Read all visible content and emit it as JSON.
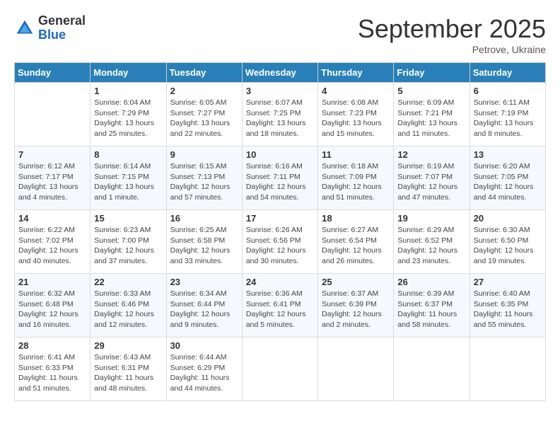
{
  "logo": {
    "general": "General",
    "blue": "Blue"
  },
  "header": {
    "month": "September 2025",
    "location": "Petrove, Ukraine"
  },
  "weekdays": [
    "Sunday",
    "Monday",
    "Tuesday",
    "Wednesday",
    "Thursday",
    "Friday",
    "Saturday"
  ],
  "weeks": [
    [
      {
        "day": "",
        "info": ""
      },
      {
        "day": "1",
        "info": "Sunrise: 6:04 AM\nSunset: 7:29 PM\nDaylight: 13 hours\nand 25 minutes."
      },
      {
        "day": "2",
        "info": "Sunrise: 6:05 AM\nSunset: 7:27 PM\nDaylight: 13 hours\nand 22 minutes."
      },
      {
        "day": "3",
        "info": "Sunrise: 6:07 AM\nSunset: 7:25 PM\nDaylight: 13 hours\nand 18 minutes."
      },
      {
        "day": "4",
        "info": "Sunrise: 6:08 AM\nSunset: 7:23 PM\nDaylight: 13 hours\nand 15 minutes."
      },
      {
        "day": "5",
        "info": "Sunrise: 6:09 AM\nSunset: 7:21 PM\nDaylight: 13 hours\nand 11 minutes."
      },
      {
        "day": "6",
        "info": "Sunrise: 6:11 AM\nSunset: 7:19 PM\nDaylight: 13 hours\nand 8 minutes."
      }
    ],
    [
      {
        "day": "7",
        "info": "Sunrise: 6:12 AM\nSunset: 7:17 PM\nDaylight: 13 hours\nand 4 minutes."
      },
      {
        "day": "8",
        "info": "Sunrise: 6:14 AM\nSunset: 7:15 PM\nDaylight: 13 hours\nand 1 minute."
      },
      {
        "day": "9",
        "info": "Sunrise: 6:15 AM\nSunset: 7:13 PM\nDaylight: 12 hours\nand 57 minutes."
      },
      {
        "day": "10",
        "info": "Sunrise: 6:16 AM\nSunset: 7:11 PM\nDaylight: 12 hours\nand 54 minutes."
      },
      {
        "day": "11",
        "info": "Sunrise: 6:18 AM\nSunset: 7:09 PM\nDaylight: 12 hours\nand 51 minutes."
      },
      {
        "day": "12",
        "info": "Sunrise: 6:19 AM\nSunset: 7:07 PM\nDaylight: 12 hours\nand 47 minutes."
      },
      {
        "day": "13",
        "info": "Sunrise: 6:20 AM\nSunset: 7:05 PM\nDaylight: 12 hours\nand 44 minutes."
      }
    ],
    [
      {
        "day": "14",
        "info": "Sunrise: 6:22 AM\nSunset: 7:02 PM\nDaylight: 12 hours\nand 40 minutes."
      },
      {
        "day": "15",
        "info": "Sunrise: 6:23 AM\nSunset: 7:00 PM\nDaylight: 12 hours\nand 37 minutes."
      },
      {
        "day": "16",
        "info": "Sunrise: 6:25 AM\nSunset: 6:58 PM\nDaylight: 12 hours\nand 33 minutes."
      },
      {
        "day": "17",
        "info": "Sunrise: 6:26 AM\nSunset: 6:56 PM\nDaylight: 12 hours\nand 30 minutes."
      },
      {
        "day": "18",
        "info": "Sunrise: 6:27 AM\nSunset: 6:54 PM\nDaylight: 12 hours\nand 26 minutes."
      },
      {
        "day": "19",
        "info": "Sunrise: 6:29 AM\nSunset: 6:52 PM\nDaylight: 12 hours\nand 23 minutes."
      },
      {
        "day": "20",
        "info": "Sunrise: 6:30 AM\nSunset: 6:50 PM\nDaylight: 12 hours\nand 19 minutes."
      }
    ],
    [
      {
        "day": "21",
        "info": "Sunrise: 6:32 AM\nSunset: 6:48 PM\nDaylight: 12 hours\nand 16 minutes."
      },
      {
        "day": "22",
        "info": "Sunrise: 6:33 AM\nSunset: 6:46 PM\nDaylight: 12 hours\nand 12 minutes."
      },
      {
        "day": "23",
        "info": "Sunrise: 6:34 AM\nSunset: 6:44 PM\nDaylight: 12 hours\nand 9 minutes."
      },
      {
        "day": "24",
        "info": "Sunrise: 6:36 AM\nSunset: 6:41 PM\nDaylight: 12 hours\nand 5 minutes."
      },
      {
        "day": "25",
        "info": "Sunrise: 6:37 AM\nSunset: 6:39 PM\nDaylight: 12 hours\nand 2 minutes."
      },
      {
        "day": "26",
        "info": "Sunrise: 6:39 AM\nSunset: 6:37 PM\nDaylight: 11 hours\nand 58 minutes."
      },
      {
        "day": "27",
        "info": "Sunrise: 6:40 AM\nSunset: 6:35 PM\nDaylight: 11 hours\nand 55 minutes."
      }
    ],
    [
      {
        "day": "28",
        "info": "Sunrise: 6:41 AM\nSunset: 6:33 PM\nDaylight: 11 hours\nand 51 minutes."
      },
      {
        "day": "29",
        "info": "Sunrise: 6:43 AM\nSunset: 6:31 PM\nDaylight: 11 hours\nand 48 minutes."
      },
      {
        "day": "30",
        "info": "Sunrise: 6:44 AM\nSunset: 6:29 PM\nDaylight: 11 hours\nand 44 minutes."
      },
      {
        "day": "",
        "info": ""
      },
      {
        "day": "",
        "info": ""
      },
      {
        "day": "",
        "info": ""
      },
      {
        "day": "",
        "info": ""
      }
    ]
  ]
}
